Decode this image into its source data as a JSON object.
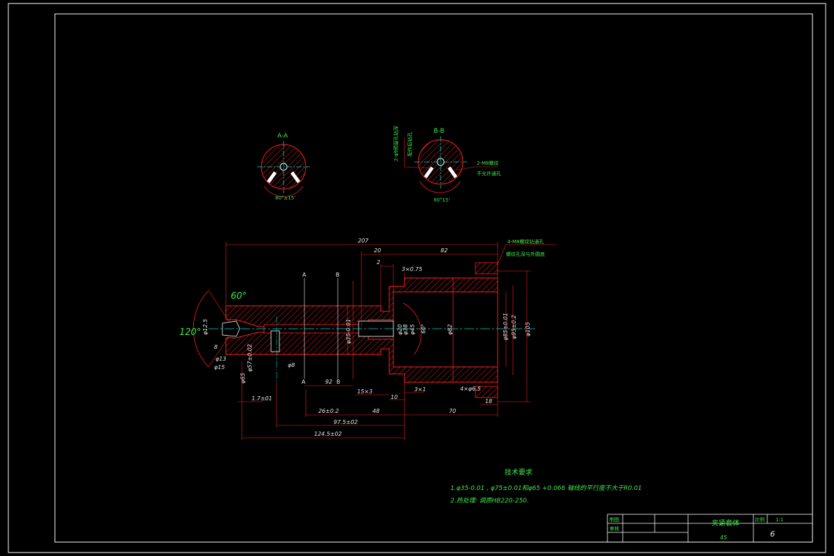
{
  "views": {
    "aa": {
      "label": "A-A",
      "angle": "80°±15'"
    },
    "bb": {
      "label": "B-B",
      "angle": "80°15'",
      "note_left_1": "2-φ9预留孔钻深",
      "note_left_2": "配作后钻孔",
      "note_right_1": "2-M8螺纹",
      "note_right_2": "不允许通孔"
    }
  },
  "main_view": {
    "overall_length": "207",
    "dim_20": "20",
    "dim_82": "82",
    "dim_2": "2",
    "chamfer_3x075": "3×0.75",
    "angle_60": "60°",
    "angle_120": "120°",
    "section_a": "A",
    "section_b": "B",
    "dim_92": "92",
    "dim_26": "26±0.2",
    "dim_48": "48",
    "dim_70": "70",
    "dim_975": "97.5±02",
    "dim_1245": "124.5±02",
    "dim_15x3": "15×3",
    "dim_10": "10",
    "dim_3x1": "3×1",
    "dim_18": "18",
    "dim_17": "1.7±01",
    "dim_4ph65": "4×φ6.5",
    "dia_125": "φ12.5",
    "dia_13": "φ13",
    "dia_15": "φ15",
    "dia_8": "φ8",
    "dia_35": "φ35-0.01",
    "dia_20": "φ20",
    "dia_38": "φ38",
    "dia_45": "φ45",
    "dia_60": "60°",
    "dia_82": "φ82",
    "dia_85": "φ85±0.01",
    "dia_95": "φ95±0.2",
    "dia_105": "φ105",
    "dia_57": "φ57±0.02",
    "dia_65": "φ65",
    "note_thread_1": "4-M8螺纹钻通孔",
    "note_thread_2": "螺纹孔深与外圆底",
    "m8": "M8",
    "dim_8": "8"
  },
  "tech_req": {
    "title": "技术要求",
    "line1": "1.φ35-0.01 , φ75±0.01和φ65 +0.066 轴线的平行度不大于R0.01",
    "line2": "2.热处理: 调质HB220-250."
  },
  "title_block": {
    "drawn": "制图",
    "checked": "审核",
    "part_name": "夹紧套体",
    "material": "45",
    "scale_label": "比例",
    "scale_value": "1:1",
    "sheet": "6"
  },
  "colors": {
    "outline": "#ffffff",
    "geometry": "#ff2020",
    "centerline": "#00d8d8",
    "text": "#3fe84a"
  }
}
